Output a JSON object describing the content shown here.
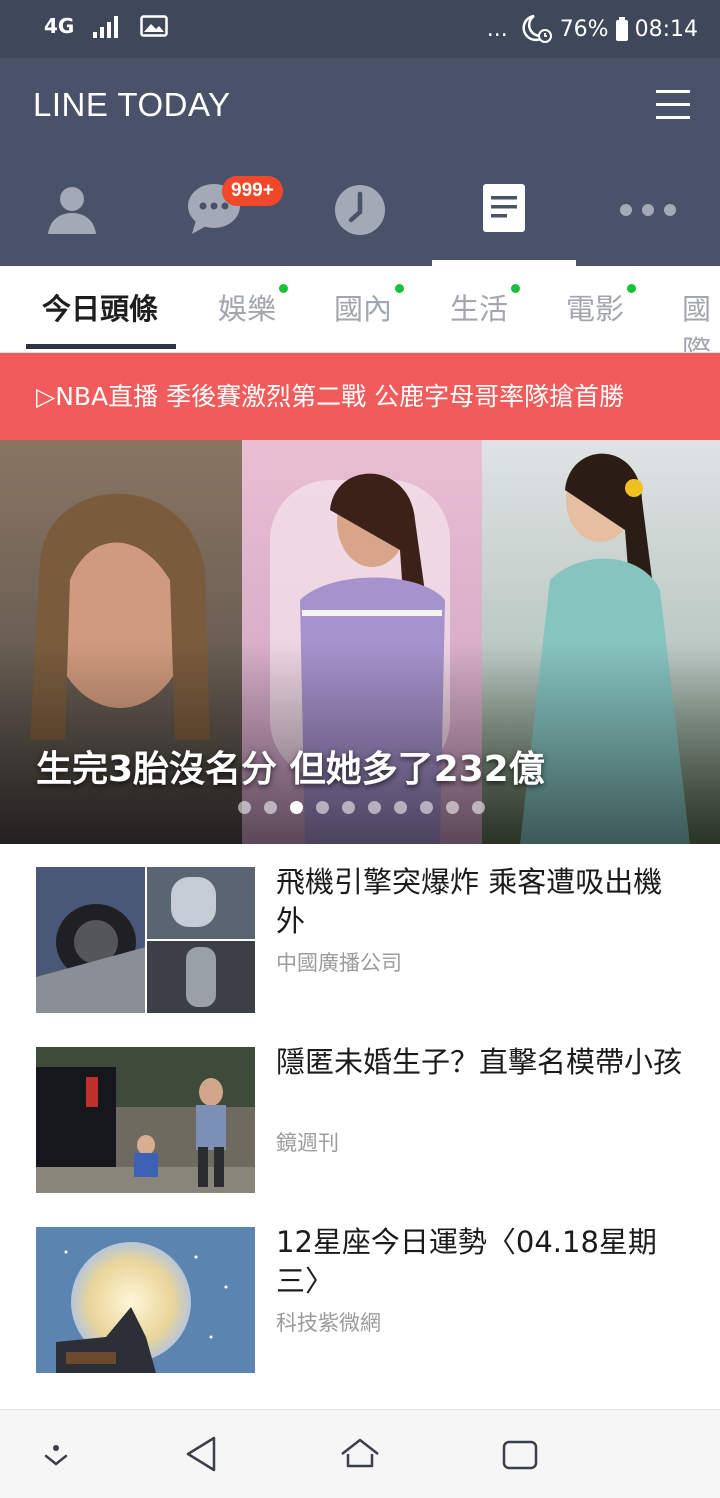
{
  "status_bar": {
    "network": "4G",
    "dots": "...",
    "battery": "76%",
    "time": "08:14"
  },
  "header": {
    "title": "LINE TODAY",
    "menu_icon": "hamburger-menu-icon",
    "chat_badge": "999+",
    "nav_icons": [
      "friends-icon",
      "chat-icon",
      "timeline-icon",
      "news-icon",
      "more-icon"
    ],
    "active_nav": "news-icon"
  },
  "tabs": [
    {
      "label": "今日頭條",
      "active": true
    },
    {
      "label": "娛樂",
      "dot": true
    },
    {
      "label": "國內",
      "dot": true
    },
    {
      "label": "生活",
      "dot": true
    },
    {
      "label": "電影",
      "dot": true
    },
    {
      "label": "國際"
    }
  ],
  "banner": {
    "text": "▷NBA直播 季後賽激烈第二戰 公鹿字母哥率隊搶首勝",
    "color": "#f25b5b"
  },
  "hero": {
    "caption": "生完3胎沒名分 但她多了232億",
    "dot_count": 10,
    "active_dot": 2
  },
  "articles": [
    {
      "title": "飛機引擎突爆炸 乘客遭吸出機外",
      "source": "中國廣播公司"
    },
    {
      "title": "隱匿未婚生子？直擊名模帶小孩",
      "source": "鏡週刊"
    },
    {
      "title": "12星座今日運勢〈04.18星期三〉",
      "source": "科技紫微網"
    }
  ],
  "bottom_nav": [
    "notification-drawer-icon",
    "back-icon",
    "home-icon",
    "recent-apps-icon"
  ],
  "colors": {
    "header_bg": "#4a5269",
    "status_bg": "#3f475a",
    "badge": "#f2482a",
    "tab_dot": "#17c23a"
  }
}
